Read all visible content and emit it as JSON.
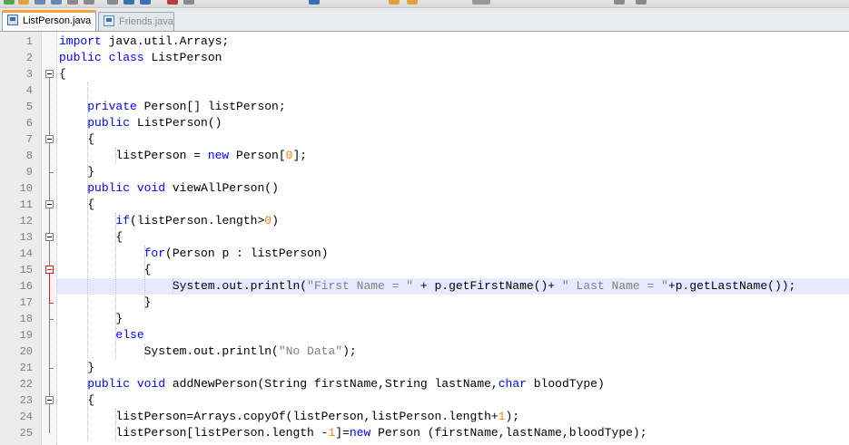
{
  "tabs": [
    {
      "label": "ListPerson.java",
      "active": true
    },
    {
      "label": "Friends.java",
      "active": false
    }
  ],
  "editor": {
    "current_line": 16,
    "lines": [
      {
        "n": "1",
        "t": "import java.util.Arrays;"
      },
      {
        "n": "2",
        "t": "public class ListPerson"
      },
      {
        "n": "3",
        "t": "{"
      },
      {
        "n": "4",
        "t": ""
      },
      {
        "n": "5",
        "t": "    private Person[] listPerson;"
      },
      {
        "n": "6",
        "t": "    public ListPerson()"
      },
      {
        "n": "7",
        "t": "    {"
      },
      {
        "n": "8",
        "t": "        listPerson = new Person[0];"
      },
      {
        "n": "9",
        "t": "    }"
      },
      {
        "n": "10",
        "t": "    public void viewAllPerson()"
      },
      {
        "n": "11",
        "t": "    {"
      },
      {
        "n": "12",
        "t": "        if(listPerson.length>0)"
      },
      {
        "n": "13",
        "t": "        {"
      },
      {
        "n": "14",
        "t": "            for(Person p : listPerson)"
      },
      {
        "n": "15",
        "t": "            {"
      },
      {
        "n": "16",
        "t": "                System.out.println(\"First Name = \" + p.getFirstName()+ \" Last Name = \"+p.getLastName());"
      },
      {
        "n": "17",
        "t": "            }"
      },
      {
        "n": "18",
        "t": "        }"
      },
      {
        "n": "19",
        "t": "        else"
      },
      {
        "n": "20",
        "t": "            System.out.println(\"No Data\");"
      },
      {
        "n": "21",
        "t": "    }"
      },
      {
        "n": "22",
        "t": "    public void addNewPerson(String firstName,String lastName,char bloodType)"
      },
      {
        "n": "23",
        "t": "    {"
      },
      {
        "n": "24",
        "t": "        listPerson=Arrays.copyOf(listPerson,listPerson.length+1);"
      },
      {
        "n": "25",
        "t": "        listPerson[listPerson.length -1]=new Person (firstName,lastName,bloodType);"
      }
    ]
  },
  "colors": {
    "keyword": "#0000ff",
    "type": "#8000ff",
    "number": "#ff8000",
    "string": "#808080",
    "current_line_bg": "#e8e8ff",
    "active_tab_accent": "#f9a13a"
  }
}
